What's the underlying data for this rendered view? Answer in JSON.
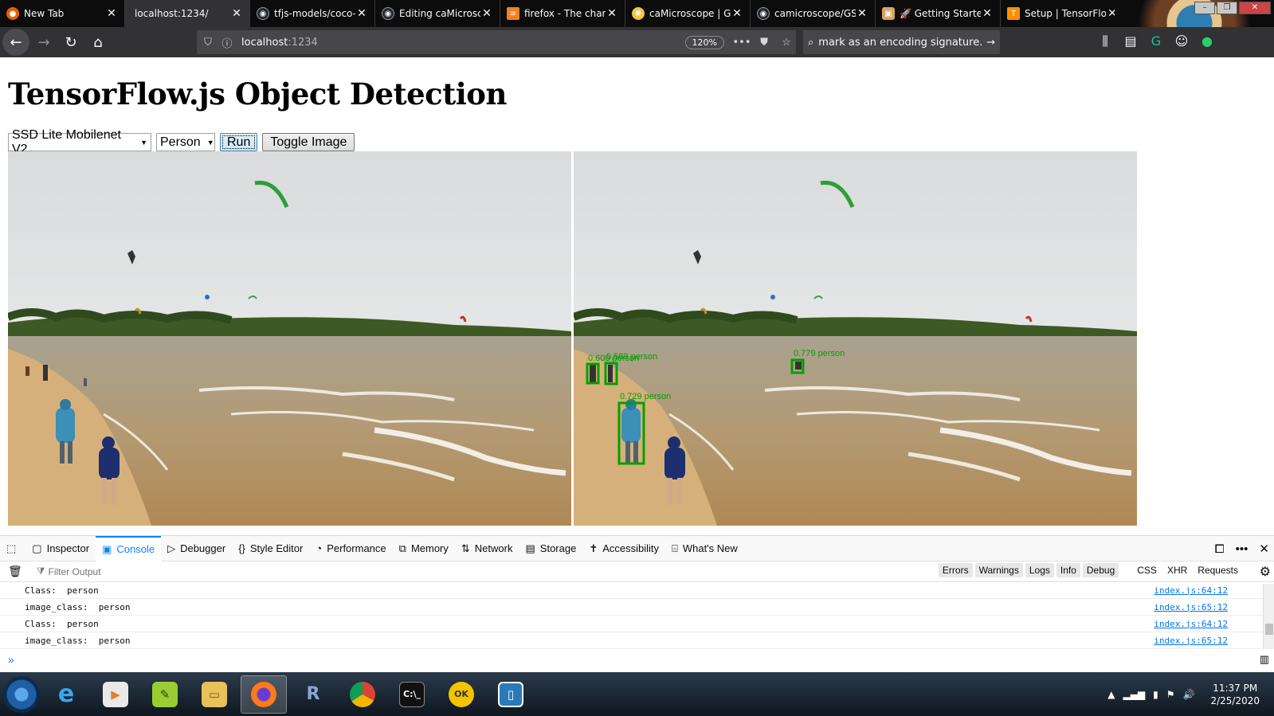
{
  "browser": {
    "tabs": [
      {
        "label": "New Tab",
        "icon": "firefox-icon",
        "color": "#e66000",
        "active": false
      },
      {
        "label": "localhost:1234/",
        "icon": "page-icon",
        "color": "#555",
        "active": true
      },
      {
        "label": "tfjs-models/coco-",
        "icon": "github-icon",
        "color": "#24292e",
        "active": false
      },
      {
        "label": "Editing caMicrosc",
        "icon": "github-icon",
        "color": "#24292e",
        "active": false
      },
      {
        "label": "firefox - The chara",
        "icon": "stackoverflow-icon",
        "color": "#f48024",
        "active": false
      },
      {
        "label": "caMicroscope | Go",
        "icon": "gsoc-icon",
        "color": "#f6c344",
        "active": false
      },
      {
        "label": "camicroscope/GSC",
        "icon": "github-icon",
        "color": "#24292e",
        "active": false
      },
      {
        "label": "🚀 Getting Started",
        "icon": "parcel-icon",
        "color": "#d9a35f",
        "active": false
      },
      {
        "label": "Setup | TensorFlo",
        "icon": "tensorflow-icon",
        "color": "#ff8f00",
        "active": false
      }
    ],
    "url_host": "localhost",
    "url_port": ":1234",
    "zoom": "120%",
    "search_text": "mark as an encoding signature."
  },
  "page": {
    "title": "TensorFlow.js Object Detection",
    "model_select": "SSD Lite Mobilenet V2",
    "class_select": "Person",
    "run_label": "Run",
    "toggle_label": "Toggle Image"
  },
  "detections": [
    {
      "score": "0.600",
      "label": "person"
    },
    {
      "score": "0.588",
      "label": "person"
    },
    {
      "score": "0.779",
      "label": "person"
    },
    {
      "score": "0.729",
      "label": "person"
    }
  ],
  "detection_color": "#00a000",
  "devtools": {
    "tabs": [
      "Inspector",
      "Console",
      "Debugger",
      "Style Editor",
      "Performance",
      "Memory",
      "Network",
      "Storage",
      "Accessibility",
      "What's New"
    ],
    "active_tab": "Console",
    "filter_placeholder": "Filter Output",
    "levels": [
      "Errors",
      "Warnings",
      "Logs",
      "Info",
      "Debug"
    ],
    "extra_filters": [
      "CSS",
      "XHR",
      "Requests"
    ],
    "logs": [
      {
        "msg": "Class:  person",
        "src": "index.js:64:12"
      },
      {
        "msg": "image_class:  person",
        "src": "index.js:65:12"
      },
      {
        "msg": "Class:  person",
        "src": "index.js:64:12"
      },
      {
        "msg": "image_class:  person",
        "src": "index.js:65:12"
      }
    ],
    "prompt": "»"
  },
  "taskbar": {
    "apps": [
      "internet-explorer-icon",
      "media-player-icon",
      "notepad-plus-icon",
      "file-explorer-icon",
      "firefox-icon",
      "r-icon",
      "chrome-icon",
      "terminal-icon",
      "ok-icon",
      "editor-icon"
    ],
    "time": "11:37 PM",
    "date": "2/25/2020"
  }
}
